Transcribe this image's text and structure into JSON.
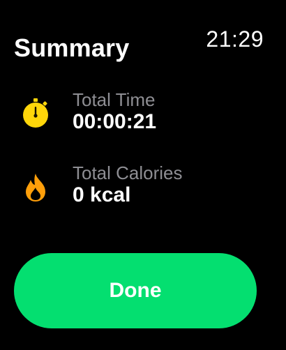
{
  "status_bar": {
    "time": "21:29"
  },
  "header": {
    "title": "Summary"
  },
  "metrics": [
    {
      "label": "Total Time",
      "value": "00:00:21",
      "icon": "stopwatch-icon",
      "color": "#ffd60a"
    },
    {
      "label": "Total Calories",
      "value": "0 kcal",
      "icon": "flame-icon",
      "color": "#ff9f0a"
    }
  ],
  "actions": {
    "done_label": "Done",
    "done_color": "#04df70"
  }
}
